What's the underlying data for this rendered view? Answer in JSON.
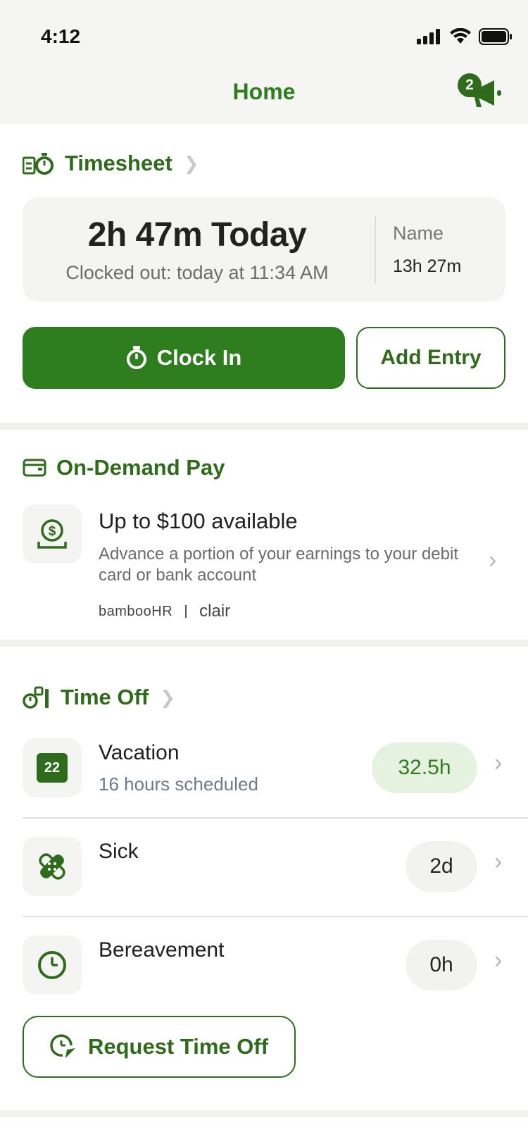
{
  "status_bar": {
    "time": "4:12"
  },
  "header": {
    "title": "Home",
    "notification_count": "2"
  },
  "timesheet": {
    "title": "Timesheet",
    "hours_today": "2h 47m Today",
    "clocked_status": "Clocked out: today at 11:34 AM",
    "name_label": "Name",
    "name_total": "13h 27m",
    "clock_in_label": "Clock In",
    "add_entry_label": "Add Entry"
  },
  "on_demand_pay": {
    "title": "On-Demand Pay",
    "headline": "Up to $100 available",
    "description": "Advance a portion of your earnings to your debit card or bank account",
    "brand_1": "bambooHR",
    "brand_2": "clair"
  },
  "time_off": {
    "title": "Time Off",
    "items": [
      {
        "name": "Vacation",
        "subtitle": "16 hours scheduled",
        "balance": "32.5h",
        "icon_text": "22",
        "icon": "calendar-icon"
      },
      {
        "name": "Sick",
        "subtitle": "",
        "balance": "2d",
        "icon": "bandage-icon"
      },
      {
        "name": "Bereavement",
        "subtitle": "",
        "balance": "0h",
        "icon": "clock-icon"
      }
    ],
    "request_label": "Request Time Off"
  },
  "colors": {
    "brand_green": "#2e7d1e",
    "dark_green": "#2e6b1a",
    "highlight_pill": "#e6f2e0",
    "neutral_pill": "#f2f2f0"
  }
}
